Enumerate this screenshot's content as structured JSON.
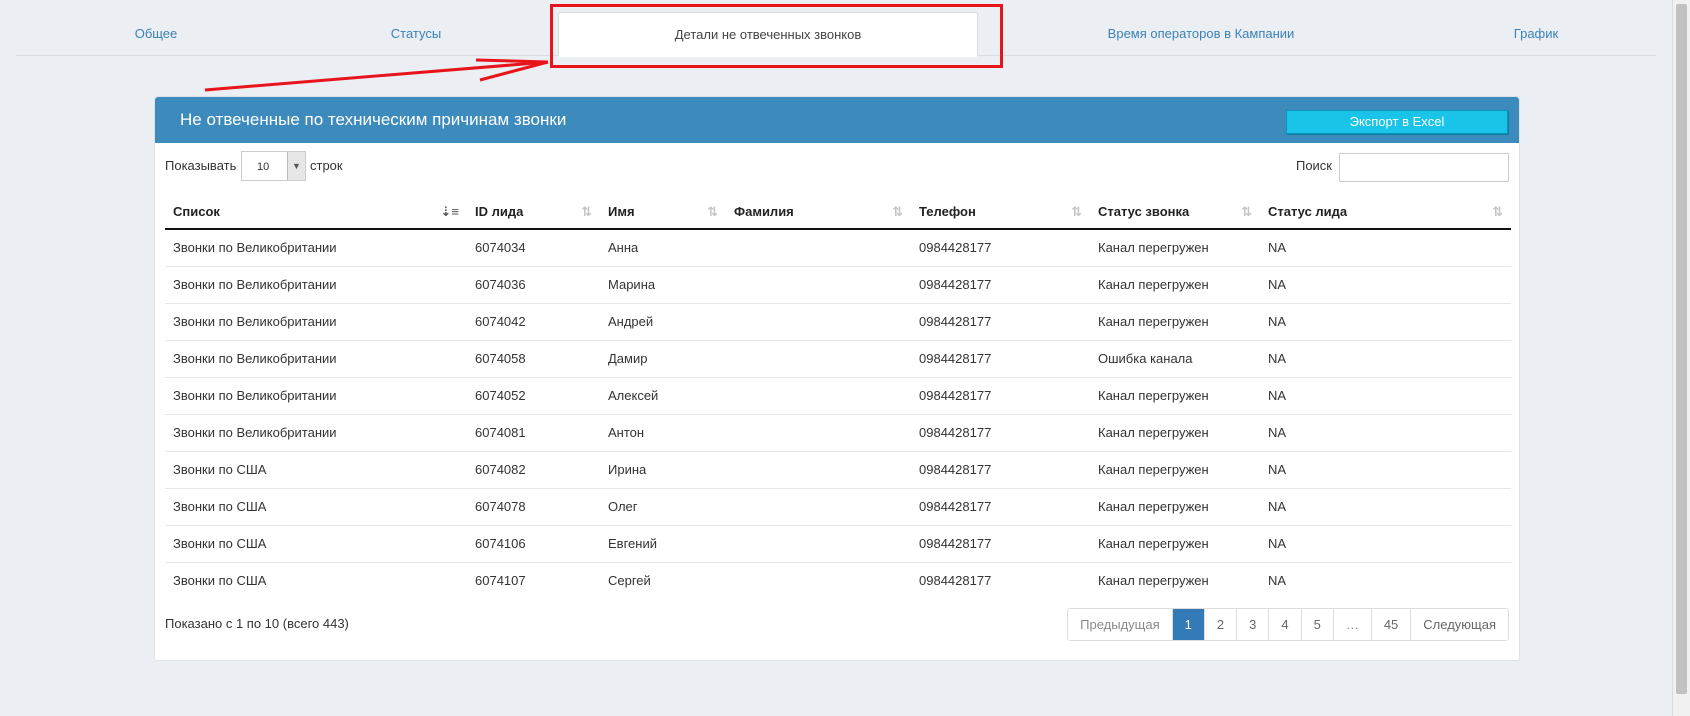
{
  "tabs": [
    {
      "label": "Общее"
    },
    {
      "label": "Статусы"
    },
    {
      "label": "Детали не отвеченных звонков",
      "active": true
    },
    {
      "label": "Время операторов в Кампании"
    },
    {
      "label": "График"
    }
  ],
  "panel": {
    "title": "Не отвеченные по техническим причинам звонки",
    "export_label": "Экспорт в Excel"
  },
  "controls": {
    "show_label": "Показывать",
    "length_value": "10",
    "rows_label": "строк",
    "search_label": "Поиск",
    "search_value": ""
  },
  "table": {
    "columns": [
      "Список",
      "ID лида",
      "Имя",
      "Фамилия",
      "Телефон",
      "Статус звонка",
      "Статус лида"
    ],
    "rows": [
      [
        "Звонки по Великобритании",
        "6074034",
        "Анна",
        "",
        "0984428177",
        "Канал перегружен",
        "NA"
      ],
      [
        "Звонки по Великобритании",
        "6074036",
        "Марина",
        "",
        "0984428177",
        "Канал перегружен",
        "NA"
      ],
      [
        "Звонки по Великобритании",
        "6074042",
        "Андрей",
        "",
        "0984428177",
        "Канал перегружен",
        "NA"
      ],
      [
        "Звонки по Великобритании",
        "6074058",
        "Дамир",
        "",
        "0984428177",
        "Ошибка канала",
        "NA"
      ],
      [
        "Звонки по Великобритании",
        "6074052",
        "Алексей",
        "",
        "0984428177",
        "Канал перегружен",
        "NA"
      ],
      [
        "Звонки по Великобритании",
        "6074081",
        "Антон",
        "",
        "0984428177",
        "Канал перегружен",
        "NA"
      ],
      [
        "Звонки по США",
        "6074082",
        "Ирина",
        "",
        "0984428177",
        "Канал перегружен",
        "NA"
      ],
      [
        "Звонки по США",
        "6074078",
        "Олег",
        "",
        "0984428177",
        "Канал перегружен",
        "NA"
      ],
      [
        "Звонки по США",
        "6074106",
        "Евгений",
        "",
        "0984428177",
        "Канал перегружен",
        "NA"
      ],
      [
        "Звонки по США",
        "6074107",
        "Сергей",
        "",
        "0984428177",
        "Канал перегружен",
        "NA"
      ]
    ]
  },
  "footer": {
    "info": "Показано с 1 по 10 (всего 443)",
    "prev": "Предыдущая",
    "pages": [
      "1",
      "2",
      "3",
      "4",
      "5",
      "…",
      "45"
    ],
    "next": "Следующая"
  },
  "colors": {
    "header_bg": "#3d8bbd",
    "export_bg": "#1ac3e8",
    "annotation": "#e8141b",
    "active_page": "#337ab7"
  }
}
